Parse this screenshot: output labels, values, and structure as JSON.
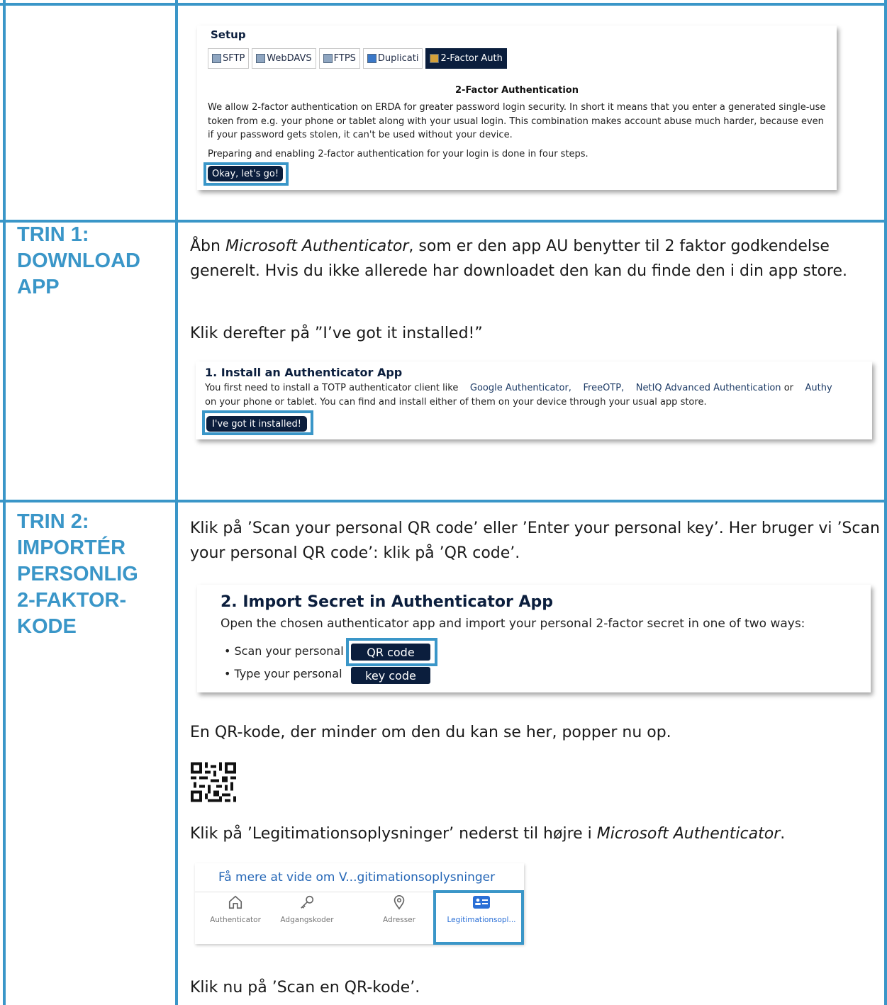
{
  "steps": [
    {
      "heading": "TRIN 1:\nDOWNLOAD\nAPP"
    },
    {
      "heading": "TRIN 2:\nIMPORTÉR\nPERSONLIG\n2-FAKTOR-\nKODE"
    }
  ],
  "setup_screenshot": {
    "title": "Setup",
    "tabs": [
      "SFTP",
      "WebDAVS",
      "FTPS",
      "Duplicati",
      "2-Factor Auth"
    ],
    "active_tab": "2-Factor Auth",
    "heading": "2-Factor Authentication",
    "text": "We allow 2-factor authentication on ERDA for greater password login security. In short it means that you enter a generated single-use token from e.g. your phone or tablet along with your usual login. This combination makes account abuse much harder, because even if your password gets stolen, it can't be used without your device.",
    "text2": "Preparing and enabling 2-factor authentication for your login is done in four steps.",
    "button": "Okay, let's go!"
  },
  "step1": {
    "para1_pre": "Åbn ",
    "para1_em": "Microsoft Authenticator",
    "para1_post": ", som er den app AU benytter til 2 faktor godkendelse generelt. Hvis du ikke allerede har downloadet den kan du finde den i din app store.",
    "para2": "Klik derefter på ”I’ve got it installed!”",
    "screenshot": {
      "title": "1. Install an Authenticator App",
      "text_pre": "You first need to install a TOTP authenticator client like",
      "apps": [
        "Google Authenticator,",
        "FreeOTP,",
        "NetIQ Advanced Authentication",
        "Authy"
      ],
      "or": "or",
      "text_line2": "on your phone or tablet. You can find and install either of them on your device through your usual app store.",
      "button": "I've got it installed!"
    }
  },
  "step2": {
    "para1": "Klik på ’Scan your personal QR code’ eller ’Enter your personal key’. Her bruger vi ’Scan your personal QR code’: klik på ’QR code’.",
    "screenshot": {
      "title": "2. Import Secret in Authenticator App",
      "text": "Open the chosen authenticator app and import your personal 2-factor secret in one of two ways:",
      "bullet1": "• Scan your personal",
      "button1": "QR code",
      "bullet2": "• Type your personal",
      "button2": "key code"
    },
    "para2": "En QR-kode, der minder om den du kan se her, popper nu op.",
    "para3_pre": "Klik på ’Legitimationsoplysninger’ nederst til højre i ",
    "para3_em": "Microsoft Authenticator",
    "para3_post": ".",
    "auth_screenshot": {
      "link": "Få mere at vide om V...gitimationsoplysninger",
      "items": [
        "Authenticator",
        "Adgangskoder",
        "Adresser",
        "Legitimationsopl..."
      ],
      "icons": [
        "home-icon",
        "key-icon",
        "location-pin-icon",
        "id-card-icon"
      ]
    },
    "para4": "Klik nu på ’Scan en QR-kode’."
  },
  "colors": {
    "accent": "#3a96c8",
    "dark_button": "#0b1e3d",
    "link_blue": "#2466b6"
  }
}
